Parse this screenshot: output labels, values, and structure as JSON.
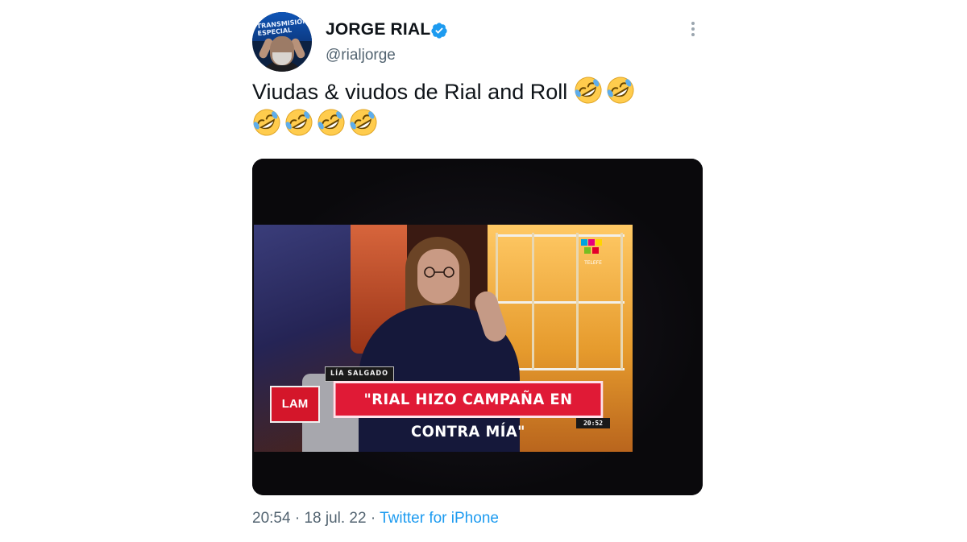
{
  "author": {
    "name": "JORGE RIAL",
    "handle": "@rialjorge",
    "avatar_text": "TRANSMISIÓN\nESPECIAL",
    "verified_icon": "verified-badge-icon"
  },
  "tweet": {
    "text": "Viudas & viudos de Rial and Roll",
    "emoji_name": "rolling-on-the-floor-laughing",
    "emoji_count_line1": 2,
    "emoji_count_line2": 4
  },
  "media": {
    "caption_name": "LÍA SALGADO",
    "headline": "\"RIAL HIZO CAMPAÑA EN CONTRA MÍA\"",
    "program_logo": "LAM",
    "clock": "20:52",
    "channel_label": "TELEFE"
  },
  "footer": {
    "time": "20:54",
    "separator": "·",
    "date": "18 jul. 22",
    "source": "Twitter for iPhone"
  },
  "colors": {
    "link": "#1d9bf0",
    "secondary_text": "#536471",
    "verified": "#1d9bf0",
    "headline_red": "#e01a36"
  }
}
